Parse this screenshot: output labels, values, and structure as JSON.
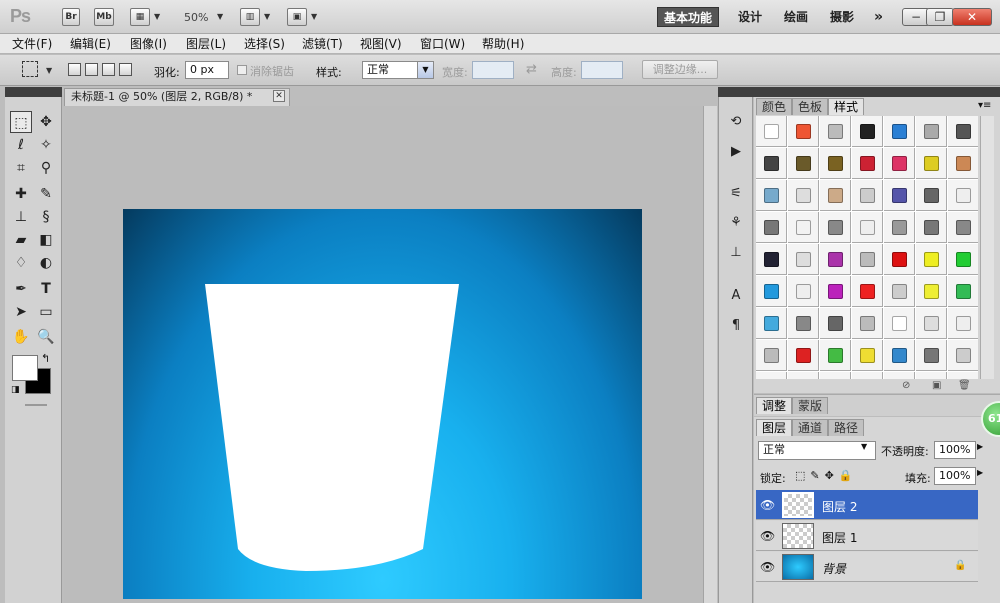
{
  "app": {
    "logo": "Ps",
    "bridge": "Br",
    "minibridge": "Mb",
    "zoom": "50%"
  },
  "workspaces": [
    "基本功能",
    "设计",
    "绘画",
    "摄影",
    "»"
  ],
  "window_controls": {
    "minimize": "−",
    "restore": "❐",
    "close": "✕"
  },
  "menu": [
    "文件(F)",
    "编辑(E)",
    "图像(I)",
    "图层(L)",
    "选择(S)",
    "滤镜(T)",
    "视图(V)",
    "窗口(W)",
    "帮助(H)"
  ],
  "options": {
    "feather_label": "羽化:",
    "feather_value": "0 px",
    "antialias_label": "消除锯齿",
    "style_label": "样式:",
    "style_value": "正常",
    "width_label": "宽度:",
    "height_label": "高度:",
    "refine_edge": "调整边缘..."
  },
  "document": {
    "tab_title": "未标题-1 @ 50% (图层 2, RGB/8) *",
    "close": "✕"
  },
  "style_panel": {
    "tabs": [
      "颜色",
      "色板",
      "样式"
    ]
  },
  "swatches": [
    "#fff",
    "#e53",
    "#bbb",
    "#222",
    "#2a7fd4",
    "#aaa",
    "#555",
    "#444",
    "#6a5a2a",
    "#7a6222",
    "#c23",
    "#d36",
    "#dc2",
    "#c85",
    "#7ac",
    "#ddd",
    "#ca8",
    "#ccc",
    "#55a",
    "#666",
    "#eee",
    "#777",
    "#f2f2f2",
    "#888",
    "#eee",
    "#999",
    "#777",
    "#888",
    "#223",
    "#ddd",
    "#a3a",
    "#bbb",
    "#d11",
    "#ee2",
    "#2c3",
    "#29d",
    "#eee",
    "#b2b",
    "#e22",
    "#ccc",
    "#ee3",
    "#3b5",
    "#4ad",
    "#888",
    "#666",
    "#bbb",
    "#fff",
    "#ddd",
    "#eee",
    "#bbb",
    "#d22",
    "#4b4",
    "#ed3",
    "#38c",
    "#777",
    "#ccc",
    "#ccc",
    "#888",
    "#ddd",
    "#aaa",
    "#eee",
    "#555",
    "#eee",
    "#999",
    "#ddd",
    "#ddd",
    "#ddd",
    "#bbb",
    "#ccc",
    "#ddd",
    "#ddd",
    "#ccc"
  ],
  "adjust_panel": {
    "tabs": [
      "调整",
      "蒙版"
    ]
  },
  "layers_panel": {
    "tabs": [
      "图层",
      "通道",
      "路径"
    ],
    "blend_mode": "正常",
    "opacity_label": "不透明度:",
    "opacity_value": "100%",
    "lock_label": "锁定:",
    "fill_label": "填充:",
    "fill_value": "100%",
    "layers": [
      {
        "name": "图层 2",
        "selected": true
      },
      {
        "name": "图层 1",
        "selected": false
      },
      {
        "name": "背景",
        "selected": false
      }
    ]
  },
  "badge": "61"
}
